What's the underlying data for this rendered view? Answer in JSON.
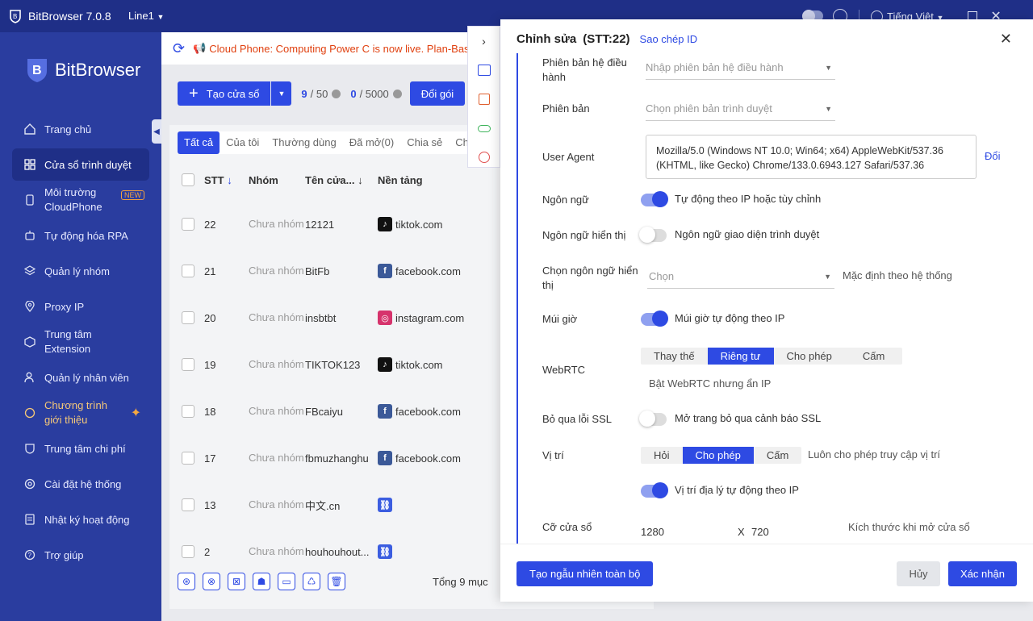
{
  "app": {
    "title": "BitBrowser 7.0.8",
    "line": "Line1",
    "language": "Tiếng Việt"
  },
  "brand": {
    "name": "BitBrowser"
  },
  "sidebar": {
    "items": [
      {
        "label": "Trang chủ",
        "icon": "home-icon"
      },
      {
        "label": "Cửa sổ trình duyệt",
        "icon": "grid-icon"
      },
      {
        "label": "Môi trường CloudPhone",
        "icon": "phone-icon",
        "badge": "NEW"
      },
      {
        "label": "Tự động hóa RPA",
        "icon": "robot-icon"
      },
      {
        "label": "Quản lý nhóm",
        "icon": "layers-icon"
      },
      {
        "label": "Proxy IP",
        "icon": "location-icon"
      },
      {
        "label": "Trung tâm Extension",
        "icon": "cube-icon"
      },
      {
        "label": "Quản lý nhân viên",
        "icon": "users-icon"
      },
      {
        "label": "Chương trình giới thiệu",
        "icon": "gift-icon"
      },
      {
        "label": "Trung tâm chi phí",
        "icon": "shield-icon"
      },
      {
        "label": "Cài đặt hệ thống",
        "icon": "gear-icon"
      },
      {
        "label": "Nhật ký hoạt động",
        "icon": "log-icon"
      },
      {
        "label": "Trợ giúp",
        "icon": "help-icon"
      }
    ]
  },
  "banner": {
    "text": "Cloud Phone: Computing Power C is now live. Plan-Bas"
  },
  "toolbar": {
    "create_label": "Tạo cửa sổ",
    "count_windows": "9",
    "limit_windows": "/ 50",
    "count_members": "0",
    "limit_members": "/ 5000",
    "change_plan_label": "Đổi gói"
  },
  "tabs": [
    "Tất cả",
    "Của tôi",
    "Thường dùng",
    "Đã mở(0)",
    "Chia sẻ",
    "Ch"
  ],
  "table": {
    "headers": {
      "stt": "STT",
      "group": "Nhóm",
      "name": "Tên cửa...",
      "platform": "Nền tảng"
    },
    "rows": [
      {
        "stt": "22",
        "group": "Chưa nhóm",
        "name": "12121",
        "platform": "tiktok.com",
        "platform_icon": "tiktok-icon"
      },
      {
        "stt": "21",
        "group": "Chưa nhóm",
        "name": "BitFb",
        "platform": "facebook.com",
        "platform_icon": "facebook-icon"
      },
      {
        "stt": "20",
        "group": "Chưa nhóm",
        "name": "insbtbt",
        "platform": "instagram.com",
        "platform_icon": "instagram-icon"
      },
      {
        "stt": "19",
        "group": "Chưa nhóm",
        "name": "TIKTOK123",
        "platform": "tiktok.com",
        "platform_icon": "tiktok-icon"
      },
      {
        "stt": "18",
        "group": "Chưa nhóm",
        "name": "FBcaiyu",
        "platform": "facebook.com",
        "platform_icon": "facebook-icon"
      },
      {
        "stt": "17",
        "group": "Chưa nhóm",
        "name": "fbmuzhanghu",
        "platform": "facebook.com",
        "platform_icon": "facebook-icon"
      },
      {
        "stt": "13",
        "group": "Chưa nhóm",
        "name": "中文.cn",
        "platform": "",
        "platform_icon": "link-icon"
      },
      {
        "stt": "2",
        "group": "Chưa nhóm",
        "name": "houhouhout...",
        "platform": "",
        "platform_icon": "link-icon"
      }
    ],
    "total": "Tổng 9 mục"
  },
  "drawer": {
    "title": "Chỉnh sửa",
    "stt": "(STT:22)",
    "copy_id": "Sao chép ID",
    "fields": {
      "os_version_label": "Phiên bản hệ điều hành",
      "os_version_placeholder": "Nhập phiên bản hệ điều hành",
      "browser_version_label": "Phiên bản",
      "browser_version_placeholder": "Chọn phiên bản trình duyệt",
      "user_agent_label": "User Agent",
      "user_agent_value": "Mozilla/5.0 (Windows NT 10.0; Win64; x64) AppleWebKit/537.36 (KHTML, like Gecko) Chrome/133.0.6943.127 Safari/537.36",
      "user_agent_change": "Đổi",
      "language_label": "Ngôn ngữ",
      "language_text": "Tự động theo IP hoặc tùy chỉnh",
      "display_language_label": "Ngôn ngữ hiển thị",
      "display_language_text": "Ngôn ngữ giao diện trình duyệt",
      "choose_display_language_label": "Chọn ngôn ngữ hiển thị",
      "choose_display_language_placeholder": "Chọn",
      "choose_display_language_hint": "Mặc định theo hệ thống",
      "timezone_label": "Múi giờ",
      "timezone_text": "Múi giờ tự động theo IP",
      "webrtc_label": "WebRTC",
      "webrtc_options": [
        "Thay thế",
        "Riêng tư",
        "Cho phép",
        "Cấm"
      ],
      "webrtc_selected": "Riêng tư",
      "webrtc_hint": "Bật WebRTC nhưng ẩn IP",
      "ssl_label": "Bỏ qua lỗi SSL",
      "ssl_text": "Mở trang bỏ qua cảnh báo SSL",
      "location_label": "Vị trí",
      "location_options": [
        "Hỏi",
        "Cho phép",
        "Cấm"
      ],
      "location_selected": "Cho phép",
      "location_hint": "Luôn cho phép truy cập vị trí",
      "geo_auto_text": "Vị trí địa lý tự động theo IP",
      "window_size_label": "Cỡ cửa sổ",
      "window_width": "1280",
      "window_x": "X",
      "window_height": "720",
      "window_size_hint": "Kích thước khi mở cửa sổ"
    },
    "toggles": {
      "language": true,
      "display_language": false,
      "timezone": true,
      "ssl": false,
      "geo_auto": true
    },
    "footer": {
      "random_all": "Tạo ngẫu nhiên toàn bộ",
      "cancel": "Hủy",
      "confirm": "Xác nhận"
    }
  },
  "colors": {
    "primary": "#2e4ae3",
    "sidebar": "#2a3d9f",
    "topbar": "#1f2f87",
    "banner_text": "#e0400f"
  }
}
